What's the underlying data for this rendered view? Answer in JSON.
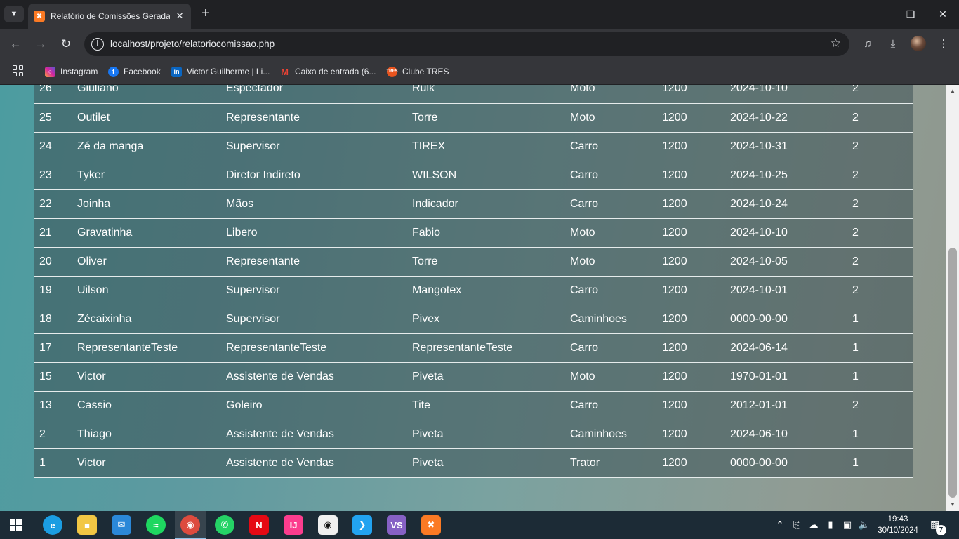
{
  "browser": {
    "tab": {
      "title": "Relatório de Comissões Geradas",
      "favicon": "xampp-icon"
    },
    "address": {
      "url": "localhost/projeto/relatoriocomissao.php"
    },
    "bookmarks": [
      {
        "label": "Instagram",
        "icon": "instagram-icon",
        "color": "#d6249f"
      },
      {
        "label": "Facebook",
        "icon": "facebook-icon",
        "color": "#1877f2"
      },
      {
        "label": "Victor Guilherme | Li...",
        "icon": "linkedin-icon",
        "color": "#0a66c2"
      },
      {
        "label": "Caixa de entrada (6...",
        "icon": "gmail-icon",
        "color": "#ea4335"
      },
      {
        "label": "Clube TRES",
        "icon": "clube-tres-icon",
        "color": "#e8541e"
      }
    ]
  },
  "table": {
    "rows": [
      [
        "26",
        "Giuliano",
        "Espectador",
        "Rulk",
        "Moto",
        "1200",
        "2024-10-10",
        "2"
      ],
      [
        "25",
        "Outilet",
        "Representante",
        "Torre",
        "Moto",
        "1200",
        "2024-10-22",
        "2"
      ],
      [
        "24",
        "Zé da manga",
        "Supervisor",
        "TIREX",
        "Carro",
        "1200",
        "2024-10-31",
        "2"
      ],
      [
        "23",
        "Tyker",
        "Diretor Indireto",
        "WILSON",
        "Carro",
        "1200",
        "2024-10-25",
        "2"
      ],
      [
        "22",
        "Joinha",
        "Mãos",
        "Indicador",
        "Carro",
        "1200",
        "2024-10-24",
        "2"
      ],
      [
        "21",
        "Gravatinha",
        "Libero",
        "Fabio",
        "Moto",
        "1200",
        "2024-10-10",
        "2"
      ],
      [
        "20",
        "Oliver",
        "Representante",
        "Torre",
        "Moto",
        "1200",
        "2024-10-05",
        "2"
      ],
      [
        "19",
        "Uilson",
        "Supervisor",
        "Mangotex",
        "Carro",
        "1200",
        "2024-10-01",
        "2"
      ],
      [
        "18",
        "Zécaixinha",
        "Supervisor",
        "Pivex",
        "Caminhoes",
        "1200",
        "0000-00-00",
        "1"
      ],
      [
        "17",
        "RepresentanteTeste",
        "RepresentanteTeste",
        "RepresentanteTeste",
        "Carro",
        "1200",
        "2024-06-14",
        "1"
      ],
      [
        "15",
        "Victor",
        "Assistente de Vendas",
        "Piveta",
        "Moto",
        "1200",
        "1970-01-01",
        "1"
      ],
      [
        "13",
        "Cassio",
        "Goleiro",
        "Tite",
        "Carro",
        "1200",
        "2012-01-01",
        "2"
      ],
      [
        "2",
        "Thiago",
        "Assistente de Vendas",
        "Piveta",
        "Caminhoes",
        "1200",
        "2024-06-10",
        "1"
      ],
      [
        "1",
        "Victor",
        "Assistente de Vendas",
        "Piveta",
        "Trator",
        "1200",
        "0000-00-00",
        "1"
      ]
    ]
  },
  "taskbar": {
    "apps": [
      {
        "name": "edge-icon",
        "color": "#1b9de2"
      },
      {
        "name": "file-explorer-icon",
        "color": "#f2c744"
      },
      {
        "name": "mail-icon",
        "color": "#2b88d8"
      },
      {
        "name": "spotify-icon",
        "color": "#1ed760"
      },
      {
        "name": "chrome-icon",
        "color": "#dd4b3e"
      },
      {
        "name": "whatsapp-icon",
        "color": "#25d366"
      },
      {
        "name": "netflix-icon",
        "color": "#e50914"
      },
      {
        "name": "intellij-icon",
        "color": "#fc3d8e"
      },
      {
        "name": "github-icon",
        "color": "#f0f0f0"
      },
      {
        "name": "vscode-icon",
        "color": "#22a3f0"
      },
      {
        "name": "visual-studio-icon",
        "color": "#8661c5"
      },
      {
        "name": "xampp-icon",
        "color": "#fb7a24"
      }
    ],
    "clock": {
      "time": "19:43",
      "date": "30/10/2024"
    },
    "notifications": "7"
  }
}
